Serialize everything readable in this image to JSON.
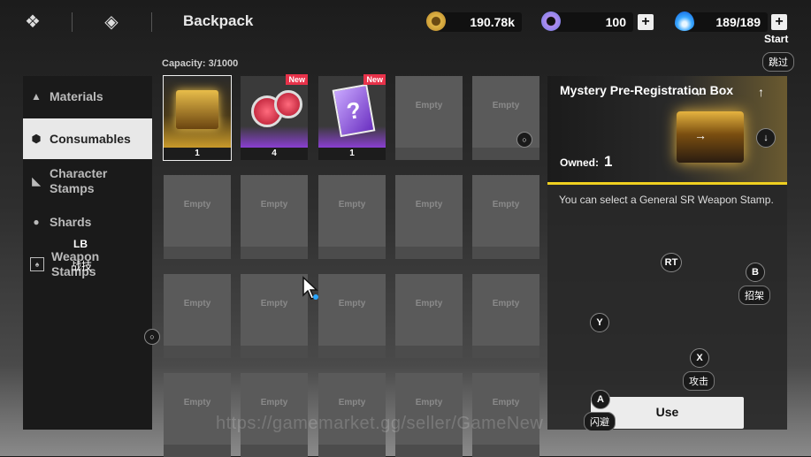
{
  "header": {
    "title": "Backpack",
    "currencies": [
      {
        "icon": "gold-coin-icon",
        "value": "190.78k"
      },
      {
        "icon": "purple-ring-icon",
        "value": "100"
      },
      {
        "icon": "blue-flame-icon",
        "value": "189/189"
      }
    ],
    "plus_label": "+"
  },
  "capacity": "Capacity: 3/1000",
  "sidebar": {
    "items": [
      {
        "label": "Materials",
        "icon": "triangle-icon"
      },
      {
        "label": "Consumables",
        "icon": "hexagon-icon"
      },
      {
        "label": "Character\nStamps",
        "icon": "stamp-icon"
      },
      {
        "label": "Shards",
        "icon": "person-icon"
      },
      {
        "label": "Weapon\nStamps",
        "icon": "card-icon"
      }
    ]
  },
  "grid": {
    "new_label": "New",
    "empty_label": "Empty",
    "items": [
      {
        "count": "1",
        "new": false,
        "rarity": "gold"
      },
      {
        "count": "4",
        "new": true,
        "rarity": "purple"
      },
      {
        "count": "1",
        "new": true,
        "rarity": "purple"
      }
    ]
  },
  "detail": {
    "name": "Mystery Pre-Registration Box",
    "owned_label": "Owned:",
    "owned_value": "1",
    "description": "You can select a General SR Weapon Stamp.",
    "use_label": "Use"
  },
  "controller": {
    "start": "Start",
    "skip": "跳过",
    "lb": "LB",
    "lb_action": "战技",
    "rt": "RT",
    "b": "B",
    "b_action": "招架",
    "y": "Y",
    "x": "X",
    "x_action": "攻击",
    "a": "A",
    "a_action": "闪避"
  },
  "watermark": "https://gamemarket.gg/seller/GameNew",
  "colors": {
    "gold": "#d9a82a",
    "purple": "#8a3fd1",
    "new": "#e8324a"
  }
}
